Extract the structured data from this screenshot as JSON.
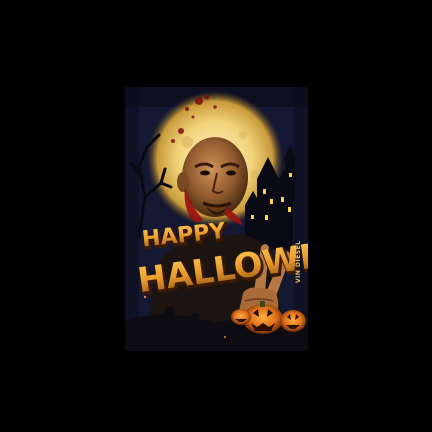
{
  "poster": {
    "headline_line1": "HAPPY",
    "headline_line2": "HALLOWEEN",
    "side_name": "VIN DIESEL"
  },
  "colors": {
    "background": "#000000",
    "sky": "#1a1d3a",
    "moon": "#f0d27a",
    "title_orange": "#e89a2c",
    "title_dark": "#5a2a0a",
    "pumpkin": "#e0701a"
  }
}
